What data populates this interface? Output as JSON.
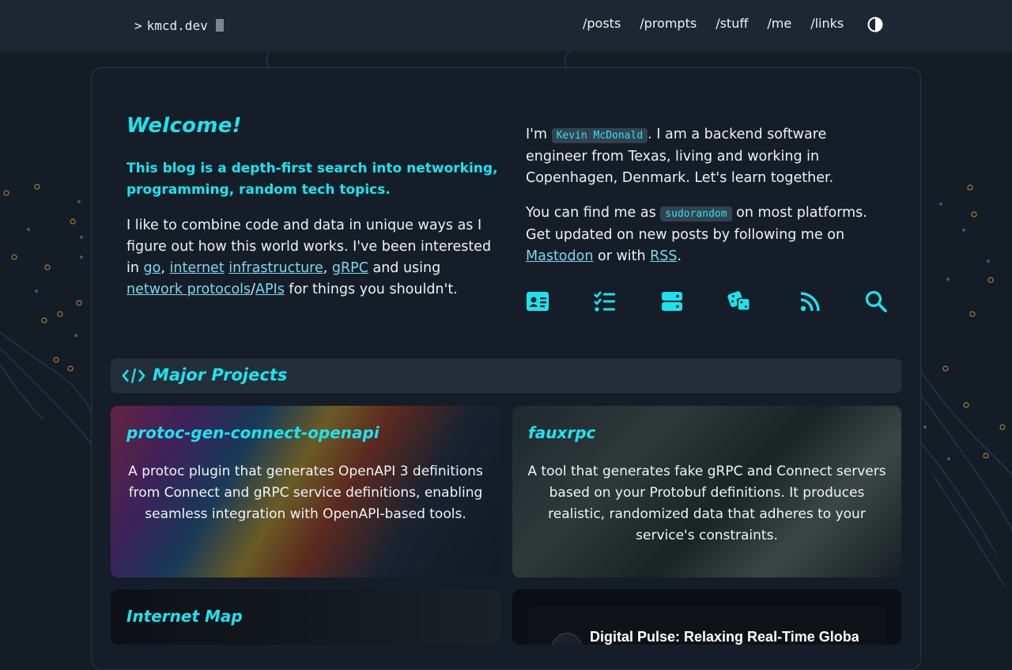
{
  "header": {
    "brand_prompt": ">",
    "brand_text": "kmcd.dev",
    "nav": [
      "/posts",
      "/prompts",
      "/stuff",
      "/me",
      "/links"
    ]
  },
  "intro": {
    "welcome": "Welcome!",
    "tagline": "This blog is a depth-first search into networking, programming, random tech topics.",
    "p1_a": "I like to combine code and data in unique ways as I figure out how this world works. I've been interested in ",
    "link_go": "go",
    "sep1": ", ",
    "link_internet": "internet",
    "sp": " ",
    "link_infrastructure": "infrastructure",
    "sep2": ", ",
    "link_grpc": "gRPC",
    "p1_b": " and using ",
    "link_network_protocols": "network protocols",
    "slash": "/",
    "link_apis": "APIs",
    "p1_c": " for things you shouldn't.",
    "p2_a": "I'm ",
    "name_code": "Kevin McDonald",
    "p2_b": ". I am a backend software engineer from Texas, living and working in Copenhagen, Denmark. Let's learn together.",
    "p3_a": "You can find me as ",
    "handle_code": "sudorandom",
    "p3_b": " on most platforms. Get updated on new posts by following me on ",
    "link_mastodon": "Mastodon",
    "p3_c": " or with ",
    "link_rss": "RSS",
    "p3_d": "."
  },
  "icons": [
    "contact-card-icon",
    "checklist-icon",
    "server-icon",
    "dice-icon",
    "rss-icon",
    "search-icon"
  ],
  "accent_color": "#1be4f0",
  "projects": {
    "heading": "Major Projects",
    "items": [
      {
        "title": "protoc-gen-connect-openapi",
        "desc": "A protoc plugin that generates OpenAPI 3 definitions from Connect and gRPC service definitions, enabling seamless integration with OpenAPI-based tools."
      },
      {
        "title": "fauxrpc",
        "desc": "A tool that generates fake gRPC and Connect servers based on your Protobuf definitions. It produces realistic, randomized data that adheres to your service's constraints."
      },
      {
        "title": "Internet Map",
        "desc": ""
      },
      {
        "title": "",
        "video_title": "Digital Pulse: Relaxing Real-Time Global I"
      }
    ]
  }
}
